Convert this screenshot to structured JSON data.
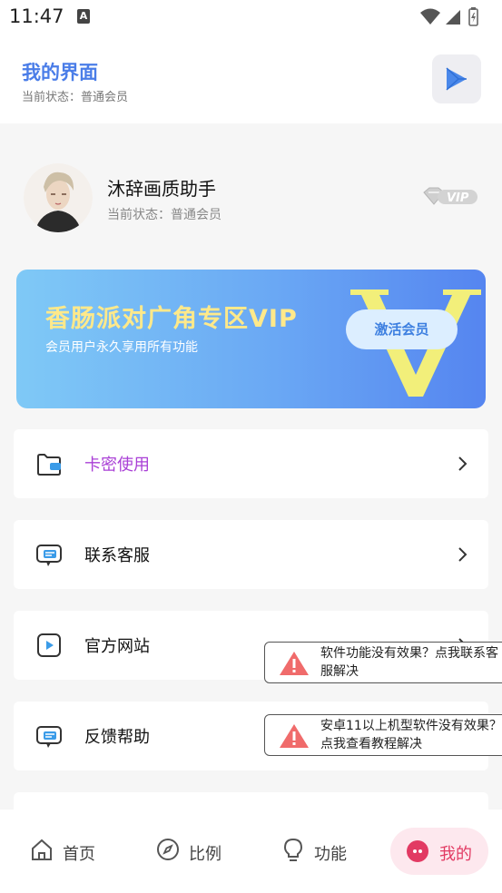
{
  "status_bar": {
    "time": "11:47",
    "notification_letter": "A"
  },
  "header": {
    "title": "我的界面",
    "subtitle": "当前状态：普通会员"
  },
  "profile": {
    "name": "沐辞画质助手",
    "status": "当前状态：普通会员",
    "badge": "VIP"
  },
  "banner": {
    "title": "香肠派对广角专区VIP",
    "subtitle": "会员用户永久享用所有功能",
    "button": "激活会员",
    "watermark": "V"
  },
  "menu": [
    {
      "label": "卡密使用",
      "icon": "card-wallet-icon"
    },
    {
      "label": "联系客服",
      "icon": "chat-support-icon"
    },
    {
      "label": "官方网站",
      "icon": "play-video-icon"
    },
    {
      "label": "反馈帮助",
      "icon": "feedback-chat-icon"
    }
  ],
  "tooltips": [
    {
      "text": "软件功能没有效果？点我联系客服解决"
    },
    {
      "text": "安卓11以上机型软件没有效果？点我查看教程解决"
    }
  ],
  "bottom_nav": [
    {
      "label": "首页",
      "icon": "home-icon"
    },
    {
      "label": "比例",
      "icon": "compass-icon"
    },
    {
      "label": "功能",
      "icon": "lightbulb-icon"
    },
    {
      "label": "我的",
      "icon": "profile-face-icon",
      "active": true
    }
  ],
  "colors": {
    "accent_blue": "#4a7de8",
    "menu_accent": "#a93fd6",
    "nav_active": "#e23a63",
    "banner_title": "#ffe98a"
  }
}
